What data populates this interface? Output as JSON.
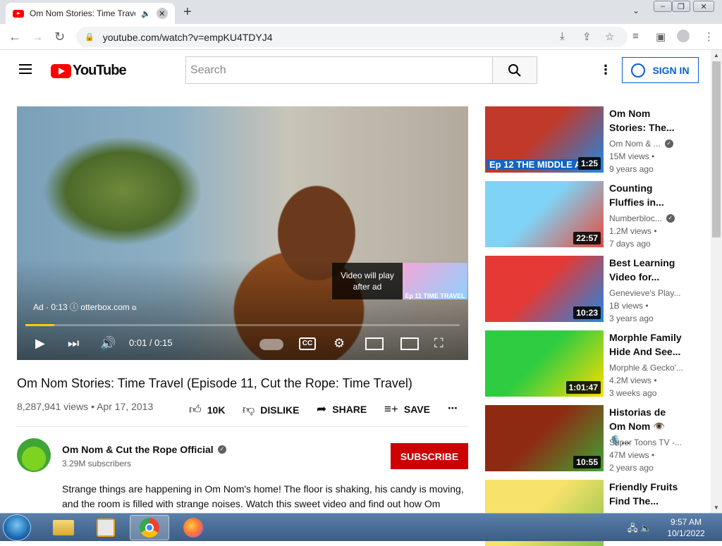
{
  "browser": {
    "tab_title": "Om Nom Stories: Time Trave",
    "url": "youtube.com/watch?v=empKU4TDYJ4",
    "new_tab": "+",
    "close_tab": "✕"
  },
  "header": {
    "logo_text": "YouTube",
    "search_placeholder": "Search",
    "sign_in": "SIGN IN"
  },
  "player": {
    "ad_label": "Ad · 0:13",
    "ad_domain": "otterbox.com",
    "next_label": "Video will play after ad",
    "next_thumb_text": "Ep 11 TIME TRAVEL",
    "time": "0:01 / 0:15",
    "progress_fraction": 0.067
  },
  "video": {
    "title": "Om Nom Stories: Time Travel (Episode 11, Cut the Rope: Time Travel)",
    "meta": "8,287,941 views • Apr 17, 2013",
    "likes": "10K",
    "dislike": "DISLIKE",
    "share": "SHARE",
    "save": "SAVE"
  },
  "channel": {
    "name": "Om Nom & Cut the Rope Official",
    "subscribers": "3.29M subscribers",
    "subscribe": "SUBSCRIBE",
    "description": "Strange things are happening in Om Nom's home! The floor is shaking, his candy is moving, and the room is filled with strange noises. Watch this sweet video and find out how Om"
  },
  "recommendations": [
    {
      "title": "Om Nom Stories: The...",
      "channel": "Om Nom & ...",
      "verified": true,
      "views": "15M views •",
      "age": "9 years ago",
      "duration": "1:25",
      "thumb_text": "Ep 12 THE MIDDLE A",
      "color1": "#c0392b",
      "color2": "#1e88e5"
    },
    {
      "title": "Counting Fluffies in...",
      "channel": "Numberbloc...",
      "verified": true,
      "views": "1.2M views •",
      "age": "7 days ago",
      "duration": "22:57",
      "thumb_text": "",
      "color1": "#7fd3f5",
      "color2": "#e74c3c"
    },
    {
      "title": "Best Learning Video for...",
      "channel": "Genevieve's Play...",
      "verified": false,
      "views": "1B views •",
      "age": "3 years ago",
      "duration": "10:23",
      "thumb_text": "",
      "color1": "#e53935",
      "color2": "#1e88e5"
    },
    {
      "title": "Morphle Family Hide And See...",
      "channel": "Morphle & Gecko'...",
      "verified": false,
      "views": "4.2M views •",
      "age": "3 weeks ago",
      "duration": "1:01:47",
      "thumb_text": "",
      "color1": "#2ecc40",
      "color2": "#ffdc00"
    },
    {
      "title": "Historias de Om Nom 👁️🎙️...",
      "channel": "Super Toons TV -...",
      "verified": false,
      "views": "47M views •",
      "age": "2 years ago",
      "duration": "10:55",
      "thumb_text": "",
      "color1": "#8e2a12",
      "color2": "#3fa535"
    },
    {
      "title": "Friendly Fruits Find The...",
      "channel": "",
      "verified": false,
      "views": "",
      "age": "",
      "duration": "",
      "thumb_text": "",
      "color1": "#f7e26b",
      "color2": "#8bc34a"
    }
  ],
  "taskbar": {
    "time": "9:57 AM",
    "date": "10/1/2022"
  }
}
